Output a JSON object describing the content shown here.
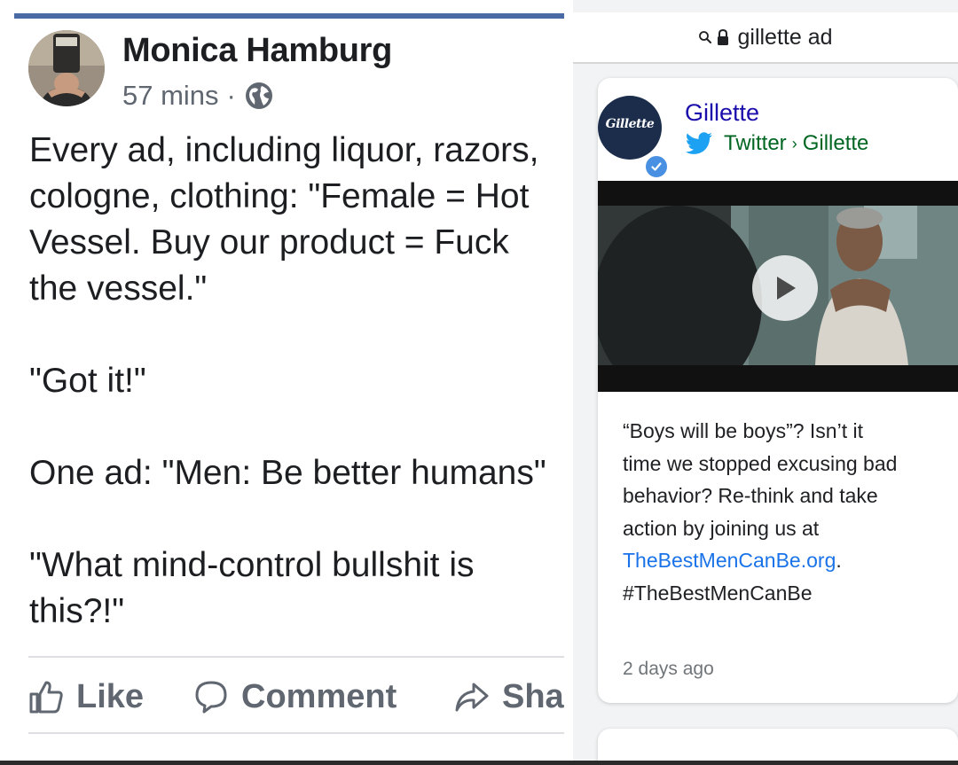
{
  "facebook_post": {
    "author": "Monica Hamburg",
    "timestamp": "57 mins",
    "separator": "·",
    "privacy_icon": "globe-icon",
    "body_lines": [
      "Every ad, including liquor, razors,",
      "cologne, clothing: \"Female = Hot",
      "Vessel. Buy our product = Fuck",
      "the vessel.\"",
      "",
      "\"Got it!\"",
      "",
      "One ad: \"Men: Be better humans\"",
      "",
      "\"What mind-control bullshit is",
      "this?!\""
    ],
    "actions": [
      {
        "label": "Like",
        "icon": "thumbs-up-icon"
      },
      {
        "label": "Comment",
        "icon": "comment-icon"
      },
      {
        "label": "Share",
        "icon": "share-icon"
      }
    ],
    "colors": {
      "top_bar": "#4a6aa5",
      "text": "#1c1e21",
      "meta": "#606770"
    }
  },
  "search_panel": {
    "url_text": "gillette ad",
    "search_icon": "search-icon",
    "lock_icon": "lock-icon",
    "result_card": {
      "logo_text": "Gillette",
      "brand_name": "Gillette",
      "source_platform": "Twitter",
      "source_separator": "›",
      "source_account": "Gillette",
      "video_play_icon": "play-icon",
      "tweet_lines": [
        "“Boys will be boys”? Isn’t it",
        "time we stopped excusing bad",
        "behavior? Re-think and take",
        "action by joining us at"
      ],
      "link_text": "TheBestMenCanBe.org",
      "link_suffix": ".",
      "hashtag": "#TheBestMenCanBe",
      "posted": "2 days ago"
    },
    "colors": {
      "link": "#1a0dab",
      "source": "#006621",
      "twitter": "#1da1f2",
      "verified": "#4a90e2"
    }
  }
}
